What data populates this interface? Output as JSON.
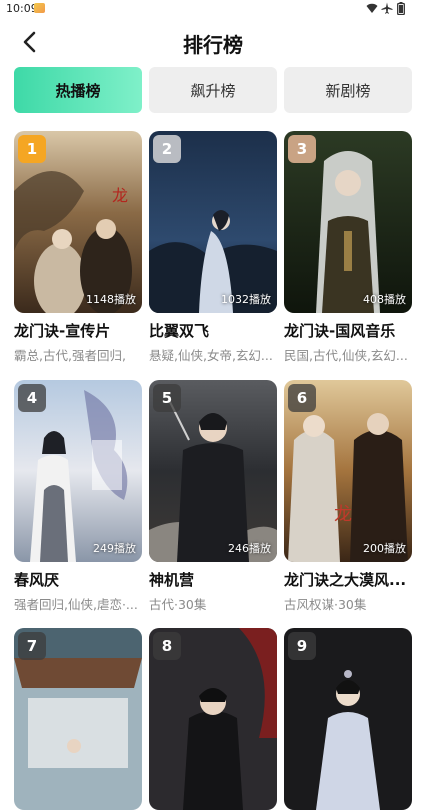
{
  "status_bar": {
    "time": "10:09",
    "icons": [
      "app-notification-icon",
      "wifi-icon",
      "airplane-icon",
      "battery-icon"
    ]
  },
  "header": {
    "title": "排行榜",
    "back_icon": "chevron-left-icon"
  },
  "tabs": [
    {
      "label": "热播榜",
      "active": true
    },
    {
      "label": "飙升榜",
      "active": false
    },
    {
      "label": "新剧榜",
      "active": false
    }
  ],
  "colors": {
    "active_tab_start": "#3ed9a7",
    "active_tab_end": "#7ff0c9",
    "rank_gold": "#f5a623",
    "rank_silver": "#b9bcc2",
    "rank_bronze": "#c9a384",
    "rank_default": "rgba(60,60,60,0.75)"
  },
  "items": [
    {
      "rank": "1",
      "title": "龙门诀-宣传片",
      "tags": "霸总,古代,强者回归,",
      "plays": "1148播放"
    },
    {
      "rank": "2",
      "title": "比翼双飞",
      "tags": "悬疑,仙侠,女帝,玄幻...",
      "plays": "1032播放"
    },
    {
      "rank": "3",
      "title": "龙门诀-国风音乐",
      "tags": "民国,古代,仙侠,玄幻...",
      "plays": "408播放"
    },
    {
      "rank": "4",
      "title": "春风厌",
      "tags": "强者回归,仙侠,虐恋·...",
      "plays": "249播放"
    },
    {
      "rank": "5",
      "title": "神机营",
      "tags": "古代·30集",
      "plays": "246播放"
    },
    {
      "rank": "6",
      "title": "龙门诀之大漠风...",
      "tags": "古风权谋·30集",
      "plays": "200播放"
    },
    {
      "rank": "7",
      "title": "",
      "tags": "",
      "plays": ""
    },
    {
      "rank": "8",
      "title": "",
      "tags": "",
      "plays": ""
    },
    {
      "rank": "9",
      "title": "",
      "tags": "",
      "plays": ""
    }
  ]
}
